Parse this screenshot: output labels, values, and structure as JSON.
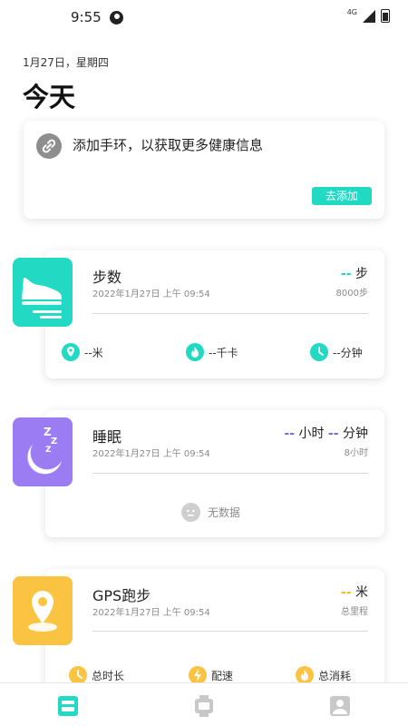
{
  "status_bar": {
    "time": "9:55",
    "network": "4G"
  },
  "header": {
    "date": "1月27日，星期四",
    "title": "今天"
  },
  "add_device": {
    "text": "添加手环，以获取更多健康信息",
    "button": "去添加"
  },
  "colors": {
    "accent": "#22d9c4",
    "steps": "#22d9c4",
    "sleep": "#9b7cf2",
    "gps": "#fbc342"
  },
  "steps": {
    "title": "步数",
    "time": "2022年1月27日 上午 09:54",
    "value": "--",
    "unit": "步",
    "goal": "8000步",
    "stats": [
      {
        "icon": "location-pin-icon",
        "text": "--米"
      },
      {
        "icon": "flame-icon",
        "text": "--千卡"
      },
      {
        "icon": "clock-icon",
        "text": "--分钟"
      }
    ]
  },
  "sleep": {
    "title": "睡眠",
    "time": "2022年1月27日 上午 09:54",
    "hours_value": "--",
    "hours_unit": "小时",
    "minutes_value": "--",
    "minutes_unit": "分钟",
    "goal": "8小时",
    "empty_text": "无数据"
  },
  "gps": {
    "title": "GPS跑步",
    "time": "2022年1月27日 上午 09:54",
    "value": "--",
    "unit": "米",
    "sub": "总里程",
    "stats": [
      {
        "icon": "clock-icon",
        "text": "总时长"
      },
      {
        "icon": "lightning-icon",
        "text": "配速"
      },
      {
        "icon": "flame-icon",
        "text": "总消耗"
      }
    ]
  },
  "nav": [
    {
      "icon": "dashboard-icon",
      "active": true
    },
    {
      "icon": "watch-icon",
      "active": false
    },
    {
      "icon": "profile-icon",
      "active": false
    }
  ]
}
